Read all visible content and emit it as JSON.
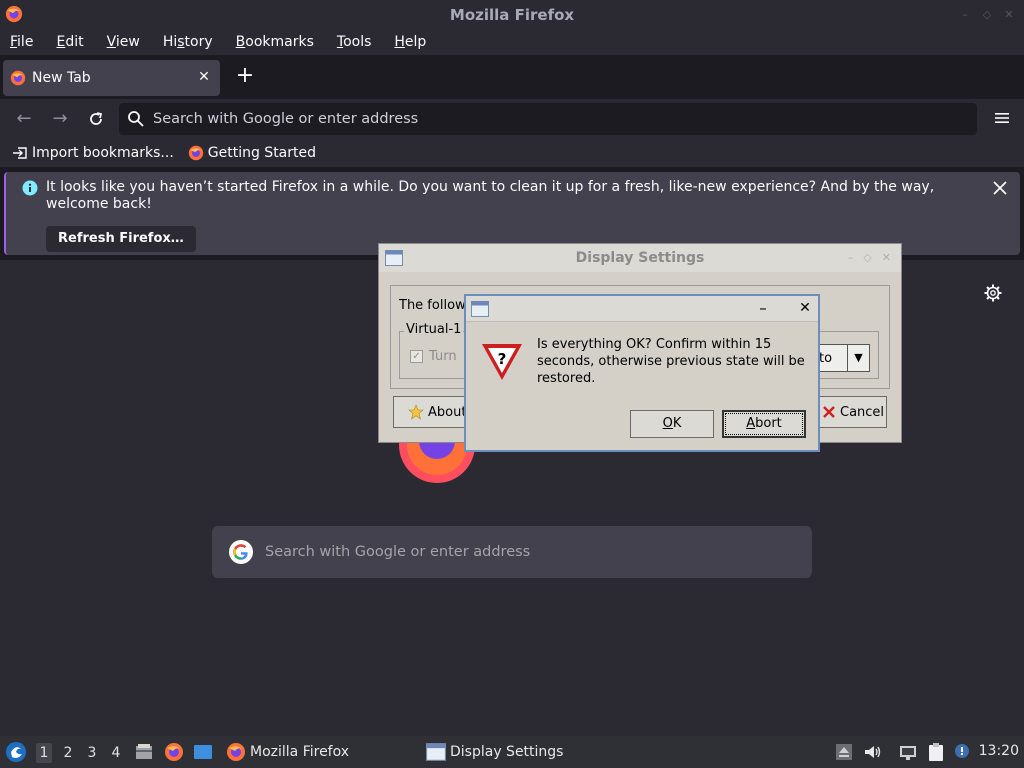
{
  "window": {
    "title": "Mozilla Firefox"
  },
  "menu": [
    {
      "key": "F",
      "rest": "ile"
    },
    {
      "key": "E",
      "rest": "dit"
    },
    {
      "key": "V",
      "rest": "iew"
    },
    {
      "key": "H",
      "rest": "istory",
      "pre": ""
    },
    {
      "key": "B",
      "rest": "ookmarks"
    },
    {
      "key": "T",
      "rest": "ools"
    },
    {
      "key": "H",
      "rest": "elp"
    }
  ],
  "menu_labels": [
    "File",
    "Edit",
    "View",
    "History",
    "Bookmarks",
    "Tools",
    "Help"
  ],
  "tab": {
    "label": "New Tab"
  },
  "urlbar": {
    "placeholder": "Search with Google or enter address"
  },
  "bookmarks": [
    {
      "label": "Import bookmarks..."
    },
    {
      "label": "Getting Started"
    }
  ],
  "notice": {
    "message": "It looks like you haven’t started Firefox in a while. Do you want to clean it up for a fresh, like-new experience? And by the way, welcome back!",
    "button": "Refresh Firefox…"
  },
  "newtab_search": {
    "placeholder": "Search with Google or enter address"
  },
  "display_settings": {
    "title": "Display Settings",
    "following_text": "The follow",
    "group_label": "Virtual-1",
    "checkbox_label": "Turn",
    "combo_value": "to",
    "about_label": "About",
    "cancel_label": "Cancel"
  },
  "confirm": {
    "message": "Is everything OK? Confirm within 15 seconds, otherwise previous state will be restored.",
    "ok_label": "OK",
    "abort_label": "Abort"
  },
  "taskbar": {
    "workspaces": [
      "1",
      "2",
      "3",
      "4"
    ],
    "tasks": [
      {
        "label": "Mozilla Firefox"
      },
      {
        "label": "Display Settings"
      }
    ],
    "clock": "13:20"
  },
  "colors": {
    "accent": "#a260e6",
    "toolbar": "#2b2a33",
    "page_bg": "#1c1b22"
  }
}
